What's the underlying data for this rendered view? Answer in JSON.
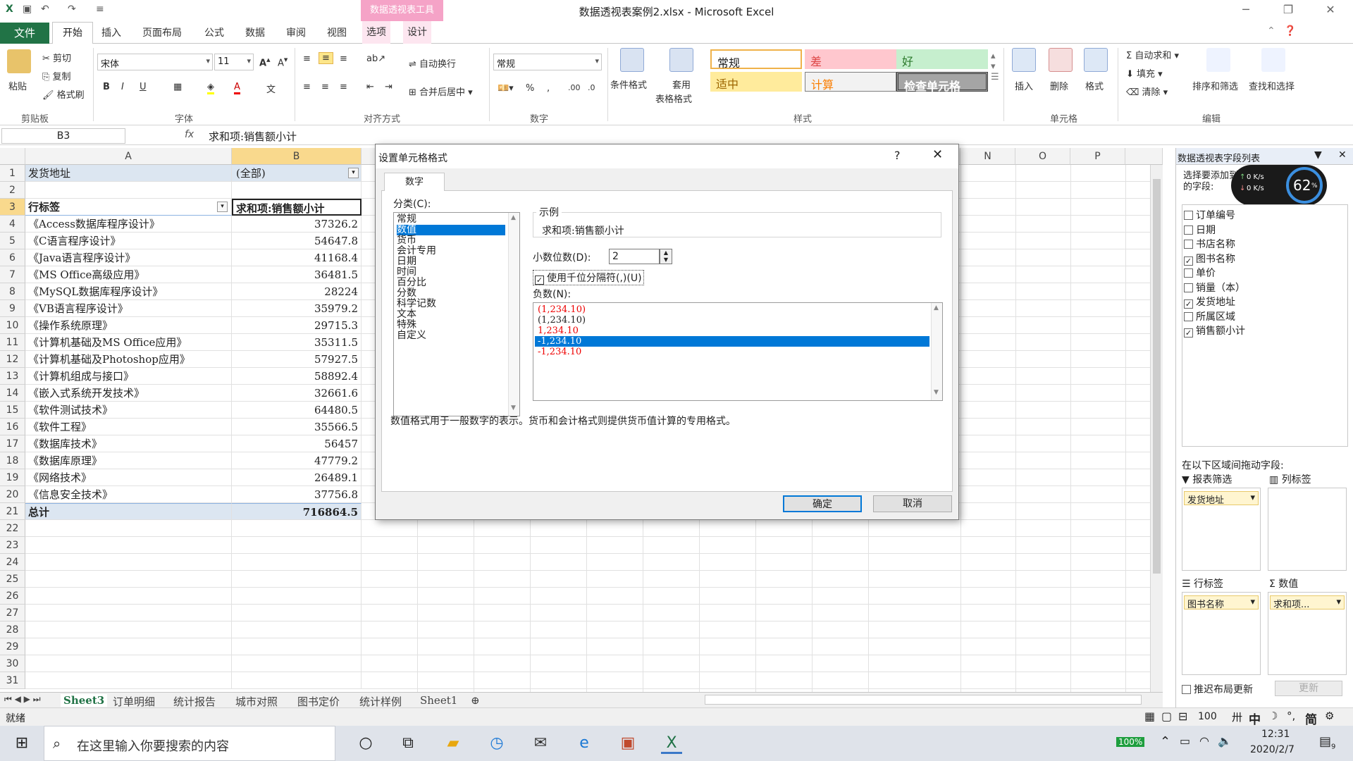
{
  "window": {
    "title": "数据透视表案例2.xlsx - Microsoft Excel",
    "context_tab_group": "数据透视表工具"
  },
  "tabs": [
    "文件",
    "开始",
    "插入",
    "页面布局",
    "公式",
    "数据",
    "审阅",
    "视图",
    "选项",
    "设计"
  ],
  "ribbon": {
    "clipboard": {
      "paste": "粘贴",
      "cut": "剪切",
      "copy": "复制",
      "format_painter": "格式刷",
      "label": "剪贴板"
    },
    "font": {
      "name": "宋体",
      "size": "11",
      "label": "字体"
    },
    "alignment": {
      "wrap": "自动换行",
      "merge": "合并后居中",
      "label": "对齐方式"
    },
    "number": {
      "format": "常规",
      "label": "数字"
    },
    "styles": {
      "conditional": "条件格式",
      "table_format_1": "套用",
      "table_format_2": "表格格式",
      "normal": "常规",
      "bad": "差",
      "good": "好",
      "neutral": "适中",
      "calc": "计算",
      "check": "检查单元格",
      "label": "样式"
    },
    "cells": {
      "insert": "插入",
      "delete": "删除",
      "format": "格式",
      "label": "单元格"
    },
    "editing": {
      "autosum": "自动求和",
      "fill": "填充",
      "clear": "清除",
      "sort": "排序和筛选",
      "find": "查找和选择",
      "label": "编辑"
    }
  },
  "formula_bar": {
    "name_box": "B3",
    "fx": "fx",
    "formula": "求和项:销售额小计"
  },
  "columns": [
    "A",
    "B",
    "N",
    "O",
    "P"
  ],
  "rows": [
    {
      "n": "1",
      "a": "发货地址",
      "b": "(全部)"
    },
    {
      "n": "2",
      "a": "",
      "b": ""
    },
    {
      "n": "3",
      "a": "行标签",
      "b": "求和项:销售额小计"
    },
    {
      "n": "4",
      "a": "《Access数据库程序设计》",
      "b": "37326.2"
    },
    {
      "n": "5",
      "a": "《C语言程序设计》",
      "b": "54647.8"
    },
    {
      "n": "6",
      "a": "《Java语言程序设计》",
      "b": "41168.4"
    },
    {
      "n": "7",
      "a": "《MS Office高级应用》",
      "b": "36481.5"
    },
    {
      "n": "8",
      "a": "《MySQL数据库程序设计》",
      "b": "28224"
    },
    {
      "n": "9",
      "a": "《VB语言程序设计》",
      "b": "35979.2"
    },
    {
      "n": "10",
      "a": "《操作系统原理》",
      "b": "29715.3"
    },
    {
      "n": "11",
      "a": "《计算机基础及MS Office应用》",
      "b": "35311.5"
    },
    {
      "n": "12",
      "a": "《计算机基础及Photoshop应用》",
      "b": "57927.5"
    },
    {
      "n": "13",
      "a": "《计算机组成与接口》",
      "b": "58892.4"
    },
    {
      "n": "14",
      "a": "《嵌入式系统开发技术》",
      "b": "32661.6"
    },
    {
      "n": "15",
      "a": "《软件测试技术》",
      "b": "64480.5"
    },
    {
      "n": "16",
      "a": "《软件工程》",
      "b": "35566.5"
    },
    {
      "n": "17",
      "a": "《数据库技术》",
      "b": "56457"
    },
    {
      "n": "18",
      "a": "《数据库原理》",
      "b": "47779.2"
    },
    {
      "n": "19",
      "a": "《网络技术》",
      "b": "26489.1"
    },
    {
      "n": "20",
      "a": "《信息安全技术》",
      "b": "37756.8"
    },
    {
      "n": "21",
      "a": "总计",
      "b": "716864.5"
    },
    {
      "n": "22",
      "a": "",
      "b": ""
    },
    {
      "n": "23",
      "a": "",
      "b": ""
    },
    {
      "n": "24",
      "a": "",
      "b": ""
    },
    {
      "n": "25",
      "a": "",
      "b": ""
    },
    {
      "n": "26",
      "a": "",
      "b": ""
    },
    {
      "n": "27",
      "a": "",
      "b": ""
    },
    {
      "n": "28",
      "a": "",
      "b": ""
    },
    {
      "n": "29",
      "a": "",
      "b": ""
    },
    {
      "n": "30",
      "a": "",
      "b": ""
    },
    {
      "n": "31",
      "a": "",
      "b": ""
    }
  ],
  "sheet_tabs": [
    "Sheet3",
    "订单明细",
    "统计报告",
    "城市对照",
    "图书定价",
    "统计样例",
    "Sheet1"
  ],
  "status": {
    "ready": "就绪",
    "zoom": "100",
    "ime": "中",
    "ime2": "简"
  },
  "field_list": {
    "title": "数据透视表字段列表",
    "choose": "选择要添加到报表的字段:",
    "fields": [
      {
        "name": "订单编号",
        "checked": false
      },
      {
        "name": "日期",
        "checked": false
      },
      {
        "name": "书店名称",
        "checked": false
      },
      {
        "name": "图书名称",
        "checked": true
      },
      {
        "name": "单价",
        "checked": false
      },
      {
        "name": "销量（本）",
        "checked": false
      },
      {
        "name": "发货地址",
        "checked": true
      },
      {
        "name": "所属区域",
        "checked": false
      },
      {
        "name": "销售额小计",
        "checked": true
      }
    ],
    "drag_hint": "在以下区域间拖动字段:",
    "filter_label": "报表筛选",
    "col_label": "列标签",
    "row_label": "行标签",
    "val_label": "数值",
    "filter_chip": "发货地址",
    "row_chip": "图书名称",
    "val_chip": "求和项...",
    "defer": "推迟布局更新",
    "update": "更新",
    "net_up": "0 K/s",
    "net_down": "0 K/s",
    "cpu": "62"
  },
  "dialog": {
    "title": "设置单元格格式",
    "help": "?",
    "tab": "数字",
    "category_label": "分类(C):",
    "categories": [
      "常规",
      "数值",
      "货币",
      "会计专用",
      "日期",
      "时间",
      "百分比",
      "分数",
      "科学记数",
      "文本",
      "特殊",
      "自定义"
    ],
    "selected_category": 1,
    "sample_label": "示例",
    "sample_value": "求和项:销售额小计",
    "decimals_label": "小数位数(D):",
    "decimals_value": "2",
    "thousands_label": "使用千位分隔符(,)(U)",
    "negative_label": "负数(N):",
    "negatives": [
      {
        "text": "(1,234.10)",
        "red": true
      },
      {
        "text": "(1,234.10)",
        "red": false
      },
      {
        "text": "1,234.10",
        "red": true
      },
      {
        "text": "-1,234.10",
        "red": false
      },
      {
        "text": "-1,234.10",
        "red": true
      }
    ],
    "selected_negative": 3,
    "description": "数值格式用于一般数字的表示。货币和会计格式则提供货币值计算的专用格式。",
    "ok": "确定",
    "cancel": "取消"
  },
  "taskbar": {
    "search_placeholder": "在这里输入你要搜索的内容",
    "battery": "100%",
    "time": "12:31",
    "date": "2020/2/7",
    "notif": "9"
  }
}
